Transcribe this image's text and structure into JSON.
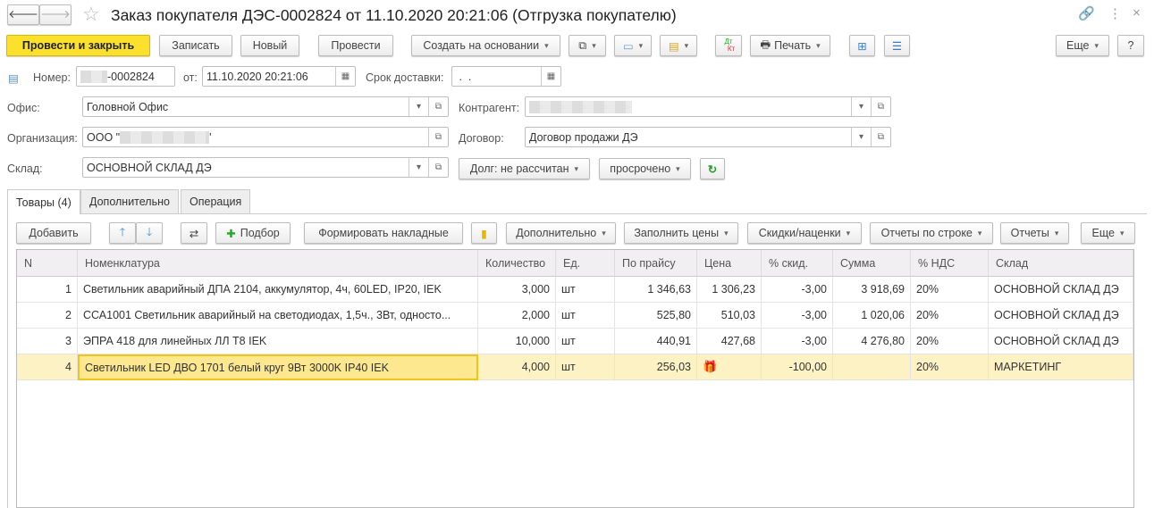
{
  "window": {
    "title": "Заказ покупателя ДЭС-0002824 от 11.10.2020 20:21:06 (Отгрузка покупателю)"
  },
  "toolbar": {
    "post_close": "Провести и закрыть",
    "save": "Записать",
    "new": "Новый",
    "post": "Провести",
    "create_based": "Создать на основании",
    "print": "Печать",
    "more": "Еще",
    "help": "?",
    "dtkt_dt": "Дт",
    "dtkt_kt": "Кт"
  },
  "form": {
    "number_label": "Номер:",
    "number_value": "-0002824",
    "date_label": "от:",
    "date_value": "11.10.2020 20:21:06",
    "delivery_label": "Срок доставки:",
    "delivery_value": " .  .",
    "office_label": "Офис:",
    "office_value": "Головной Офис",
    "org_label": "Организация:",
    "org_value": "ООО \"",
    "org_tail": "'",
    "warehouse_label": "Склад:",
    "warehouse_value": "ОСНОВНОЙ СКЛАД ДЭ",
    "counterparty_label": "Контрагент:",
    "contract_label": "Договор:",
    "contract_value": "Договор продажи ДЭ",
    "debt_button": "Долг: не рассчитан",
    "overdue_button": "просрочено"
  },
  "tabs": [
    "Товары (4)",
    "Дополнительно",
    "Операция"
  ],
  "table_toolbar": {
    "add": "Добавить",
    "pick": "Подбор",
    "form_invoices": "Формировать накладные",
    "additional": "Дополнительно",
    "fill_prices": "Заполнить цены",
    "discounts": "Скидки/наценки",
    "row_reports": "Отчеты по строке",
    "reports": "Отчеты",
    "more": "Еще"
  },
  "table": {
    "headers": [
      "N",
      "Номенклатура",
      "Количество",
      "Ед.",
      "По прайсу",
      "Цена",
      "% скид.",
      "Сумма",
      "% НДС",
      "Склад"
    ],
    "rows": [
      [
        "1",
        "Светильник аварийный ДПА 2104, аккумулятор, 4ч, 60LED, IP20, IEK",
        "3,000",
        "шт",
        "1 346,63",
        "1 306,23",
        "-3,00",
        "3 918,69",
        "20%",
        "ОСНОВНОЙ СКЛАД ДЭ"
      ],
      [
        "2",
        "ССА1001 Светильник аварийный на светодиодах, 1,5ч., 3Вт, односто...",
        "2,000",
        "шт",
        "525,80",
        "510,03",
        "-3,00",
        "1 020,06",
        "20%",
        "ОСНОВНОЙ СКЛАД ДЭ"
      ],
      [
        "3",
        "ЭПРА 418 для линейных ЛЛ Т8 IEK",
        "10,000",
        "шт",
        "440,91",
        "427,68",
        "-3,00",
        "4 276,80",
        "20%",
        "ОСНОВНОЙ СКЛАД ДЭ"
      ],
      [
        "4",
        "Светильник LED ДВО 1701 белый круг 9Вт 3000K IP40 IEK",
        "4,000",
        "шт",
        "256,03",
        "",
        "-100,00",
        "",
        "20%",
        "МАРКЕТИНГ"
      ]
    ]
  }
}
